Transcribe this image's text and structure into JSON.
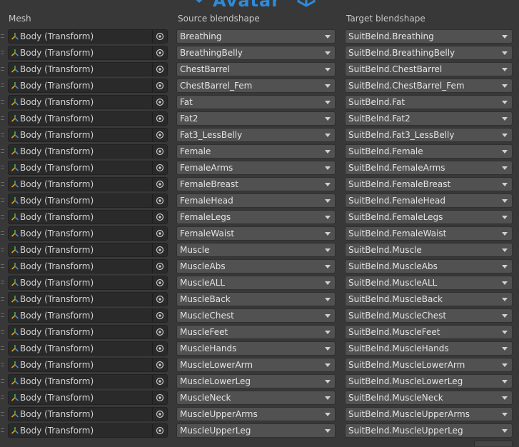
{
  "banner": {
    "title": "Avatar"
  },
  "header": {
    "mesh": "Mesh",
    "source": "Source blendshape",
    "target": "Target blendshape"
  },
  "colors": {
    "accent": "#2f8bd8",
    "mesh_icon": [
      "#e0a020",
      "#4caf50",
      "#3b8fe0"
    ]
  },
  "icons": {
    "mesh": "mesh-transform-icon",
    "picker": "object-picker-icon",
    "dropdown": "dropdown-arrow-icon",
    "drag": "drag-handle-icon"
  },
  "rows": [
    {
      "mesh": "Body (Transform)",
      "source": "Breathing",
      "target": "SuitBelnd.Breathing"
    },
    {
      "mesh": "Body (Transform)",
      "source": "BreathingBelly",
      "target": "SuitBelnd.BreathingBelly"
    },
    {
      "mesh": "Body (Transform)",
      "source": "ChestBarrel",
      "target": "SuitBelnd.ChestBarrel"
    },
    {
      "mesh": "Body (Transform)",
      "source": "ChestBarrel_Fem",
      "target": "SuitBelnd.ChestBarrel_Fem"
    },
    {
      "mesh": "Body (Transform)",
      "source": "Fat",
      "target": "SuitBelnd.Fat"
    },
    {
      "mesh": "Body (Transform)",
      "source": "Fat2",
      "target": "SuitBelnd.Fat2"
    },
    {
      "mesh": "Body (Transform)",
      "source": "Fat3_LessBelly",
      "target": "SuitBelnd.Fat3_LessBelly"
    },
    {
      "mesh": "Body (Transform)",
      "source": "Female",
      "target": "SuitBelnd.Female"
    },
    {
      "mesh": "Body (Transform)",
      "source": "FemaleArms",
      "target": "SuitBelnd.FemaleArms"
    },
    {
      "mesh": "Body (Transform)",
      "source": "FemaleBreast",
      "target": "SuitBelnd.FemaleBreast"
    },
    {
      "mesh": "Body (Transform)",
      "source": "FemaleHead",
      "target": "SuitBelnd.FemaleHead"
    },
    {
      "mesh": "Body (Transform)",
      "source": "FemaleLegs",
      "target": "SuitBelnd.FemaleLegs"
    },
    {
      "mesh": "Body (Transform)",
      "source": "FemaleWaist",
      "target": "SuitBelnd.FemaleWaist"
    },
    {
      "mesh": "Body (Transform)",
      "source": "Muscle",
      "target": "SuitBelnd.Muscle"
    },
    {
      "mesh": "Body (Transform)",
      "source": "MuscleAbs",
      "target": "SuitBelnd.MuscleAbs"
    },
    {
      "mesh": "Body (Transform)",
      "source": "MuscleALL",
      "target": "SuitBelnd.MuscleALL"
    },
    {
      "mesh": "Body (Transform)",
      "source": "MuscleBack",
      "target": "SuitBelnd.MuscleBack"
    },
    {
      "mesh": "Body (Transform)",
      "source": "MuscleChest",
      "target": "SuitBelnd.MuscleChest"
    },
    {
      "mesh": "Body (Transform)",
      "source": "MuscleFeet",
      "target": "SuitBelnd.MuscleFeet"
    },
    {
      "mesh": "Body (Transform)",
      "source": "MuscleHands",
      "target": "SuitBelnd.MuscleHands"
    },
    {
      "mesh": "Body (Transform)",
      "source": "MuscleLowerArm",
      "target": "SuitBelnd.MuscleLowerArm"
    },
    {
      "mesh": "Body (Transform)",
      "source": "MuscleLowerLeg",
      "target": "SuitBelnd.MuscleLowerLeg"
    },
    {
      "mesh": "Body (Transform)",
      "source": "MuscleNeck",
      "target": "SuitBelnd.MuscleNeck"
    },
    {
      "mesh": "Body (Transform)",
      "source": "MuscleUpperArms",
      "target": "SuitBelnd.MuscleUpperArms"
    },
    {
      "mesh": "Body (Transform)",
      "source": "MuscleUpperLeg",
      "target": "SuitBelnd.MuscleUpperLeg"
    }
  ]
}
